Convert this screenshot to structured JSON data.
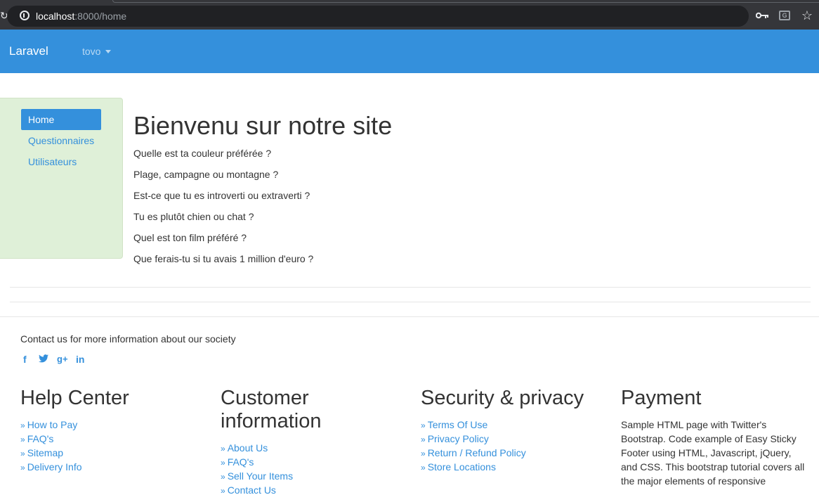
{
  "browser": {
    "url_host": "localhost",
    "url_rest": ":8000/home",
    "translate_glyph": "G",
    "star_glyph": "☆"
  },
  "navbar": {
    "brand": "Laravel",
    "user": "tovo"
  },
  "sidebar": {
    "items": [
      {
        "label": "Home",
        "active": true
      },
      {
        "label": "Questionnaires",
        "active": false
      },
      {
        "label": "Utilisateurs",
        "active": false
      }
    ]
  },
  "main": {
    "title": "Bienvenu sur notre site",
    "questions": [
      "Quelle est ta couleur préférée ?",
      "Plage, campagne ou montagne ?",
      "Est-ce que tu es introverti ou extraverti ?",
      "Tu es plutôt chien ou chat ?",
      "Quel est ton film préféré ?",
      "Que ferais-tu si tu avais 1 million d'euro ?"
    ]
  },
  "footer": {
    "contact_text": "Contact us for more information about our society",
    "social": {
      "facebook": "f",
      "twitter": "🐦",
      "google_plus": "g+",
      "linkedin": "in"
    },
    "arrow": "»",
    "columns": [
      {
        "title": "Help Center",
        "links": [
          "How to Pay",
          "FAQ's",
          "Sitemap",
          "Delivery Info"
        ]
      },
      {
        "title": "Customer information",
        "links": [
          "About Us",
          "FAQ's",
          "Sell Your Items",
          "Contact Us"
        ]
      },
      {
        "title": "Security & privacy",
        "links": [
          "Terms Of Use",
          "Privacy Policy",
          "Return / Refund Policy",
          "Store Locations"
        ]
      },
      {
        "title": "Payment",
        "text": "Sample HTML page with Twitter's Bootstrap. Code example of Easy Sticky Footer using HTML, Javascript, jQuery, and CSS. This bootstrap tutorial covers all the major elements of responsive"
      }
    ]
  },
  "colors": {
    "primary": "#3490dc",
    "sidebar_bg": "#dff0d8",
    "text": "#333333",
    "chrome_bg": "#35363a"
  }
}
